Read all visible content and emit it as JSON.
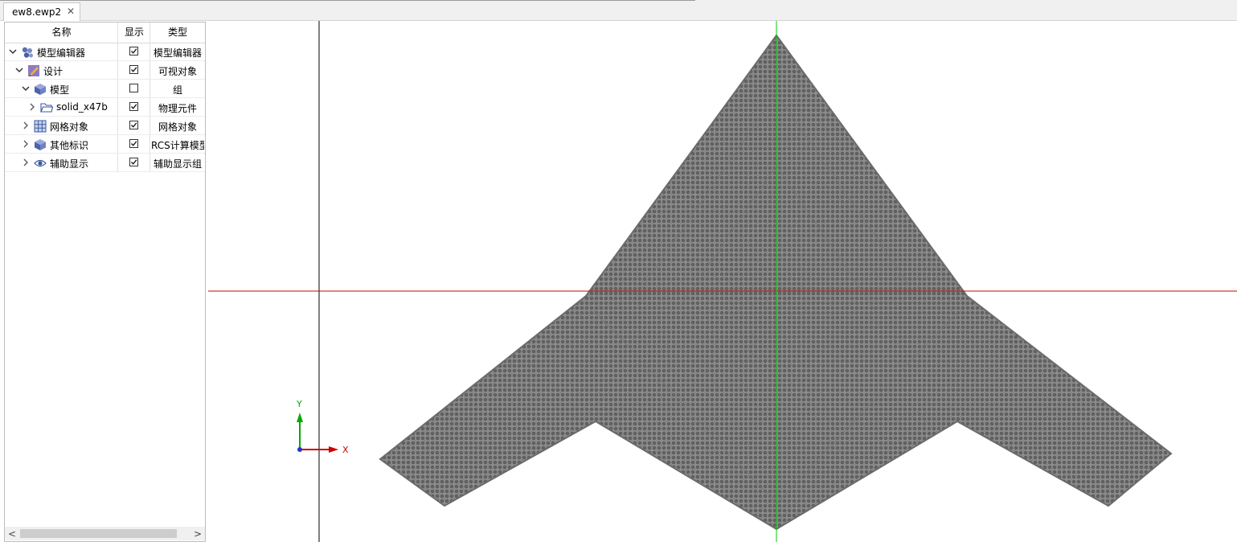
{
  "tab": {
    "title": "ew8.ewp2",
    "close_glyph": "✕"
  },
  "tree": {
    "columns": {
      "name": "名称",
      "show": "显示",
      "type": "类型"
    },
    "rows": [
      {
        "name": "模型编辑器",
        "type": "模型编辑器",
        "checked": true,
        "icon": "molecule-icon"
      },
      {
        "name": "设计",
        "type": "可视对象",
        "checked": true,
        "icon": "pencil-icon"
      },
      {
        "name": "模型",
        "type": "组",
        "checked": false,
        "icon": "cube-icon"
      },
      {
        "name": "solid_x47b",
        "type": "物理元件",
        "checked": true,
        "icon": "folder-icon"
      },
      {
        "name": "网格对象",
        "type": "网格对象",
        "checked": true,
        "icon": "grid-icon"
      },
      {
        "name": "其他标识",
        "type": "RCS计算模型",
        "checked": true,
        "icon": "cube-icon"
      },
      {
        "name": "辅助显示",
        "type": "辅助显示组",
        "checked": true,
        "icon": "eye-icon"
      }
    ],
    "scroll_left_glyph": "<",
    "scroll_right_glyph": ">"
  },
  "viewport": {
    "axis_x_label": "X",
    "axis_y_label": "Y",
    "colors": {
      "mesh": "#666666",
      "x_axis": "#cc0000",
      "y_axis": "#00cc00",
      "frame_line": "#000000"
    }
  }
}
